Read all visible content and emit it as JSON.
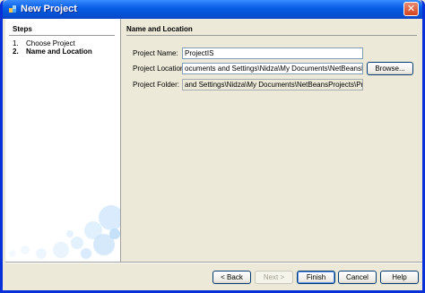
{
  "window": {
    "title": "New Project",
    "close_glyph": "✕"
  },
  "steps": {
    "heading": "Steps",
    "items": [
      {
        "num": "1.",
        "label": "Choose Project",
        "current": false
      },
      {
        "num": "2.",
        "label": "Name and Location",
        "current": true
      }
    ]
  },
  "panel": {
    "heading": "Name and Location",
    "project_name_label": "Project Name:",
    "project_name_value": "ProjectIS",
    "project_location_label": "Project Location:",
    "project_location_value": "ocuments and Settings\\Nidza\\My Documents\\NetBeansProjects",
    "browse_label": "Browse...",
    "project_folder_label": "Project Folder:",
    "project_folder_value": "and Settings\\Nidza\\My Documents\\NetBeansProjects\\ProjectIS"
  },
  "buttons": {
    "back": "< Back",
    "next": "Next >",
    "finish": "Finish",
    "cancel": "Cancel",
    "help": "Help"
  },
  "colors": {
    "titlebar": "#0a5fe6",
    "window_border": "#0831d9",
    "dialog_bg": "#ece9d8"
  }
}
